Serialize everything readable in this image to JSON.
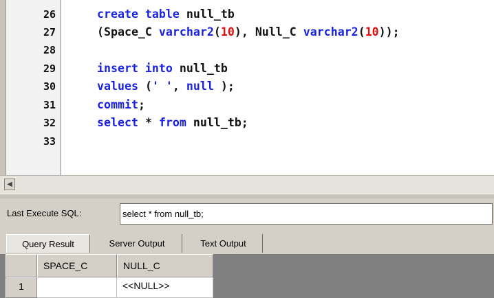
{
  "editor": {
    "lines": [
      {
        "num": "26",
        "tokens": [
          {
            "t": "create table ",
            "c": "kw"
          },
          {
            "t": "null_tb",
            "c": "txt"
          }
        ]
      },
      {
        "num": "27",
        "tokens": [
          {
            "t": "(Space_C ",
            "c": "txt"
          },
          {
            "t": "varchar2",
            "c": "kw"
          },
          {
            "t": "(",
            "c": "txt"
          },
          {
            "t": "10",
            "c": "num"
          },
          {
            "t": "), Null_C ",
            "c": "txt"
          },
          {
            "t": "varchar2",
            "c": "kw"
          },
          {
            "t": "(",
            "c": "txt"
          },
          {
            "t": "10",
            "c": "num"
          },
          {
            "t": "));",
            "c": "txt"
          }
        ]
      },
      {
        "num": "28",
        "tokens": []
      },
      {
        "num": "29",
        "tokens": [
          {
            "t": "insert into ",
            "c": "kw"
          },
          {
            "t": "null_tb",
            "c": "txt"
          }
        ]
      },
      {
        "num": "30",
        "tokens": [
          {
            "t": "values ",
            "c": "kw"
          },
          {
            "t": "(",
            "c": "txt"
          },
          {
            "t": "' '",
            "c": "str"
          },
          {
            "t": ", ",
            "c": "txt"
          },
          {
            "t": "null",
            "c": "kw"
          },
          {
            "t": " );",
            "c": "txt"
          }
        ]
      },
      {
        "num": "31",
        "tokens": [
          {
            "t": "commit",
            "c": "kw"
          },
          {
            "t": ";",
            "c": "txt"
          }
        ]
      },
      {
        "num": "32",
        "tokens": [
          {
            "t": "select ",
            "c": "kw"
          },
          {
            "t": "* ",
            "c": "txt"
          },
          {
            "t": "from ",
            "c": "kw"
          },
          {
            "t": "null_tb;",
            "c": "txt"
          }
        ]
      },
      {
        "num": "33",
        "tokens": []
      }
    ]
  },
  "scroll_left_icon": "arrow-left-icon",
  "last_execute": {
    "label": "Last Execute SQL:",
    "value": "select * from null_tb;"
  },
  "tabs": [
    {
      "label": "Query Result",
      "active": true
    },
    {
      "label": "Server Output",
      "active": false
    },
    {
      "label": "Text Output",
      "active": false
    }
  ],
  "grid": {
    "columns": [
      "SPACE_C",
      "NULL_C"
    ],
    "rows": [
      {
        "row_num": "1",
        "cells": [
          "",
          "<<NULL>>"
        ]
      }
    ]
  }
}
